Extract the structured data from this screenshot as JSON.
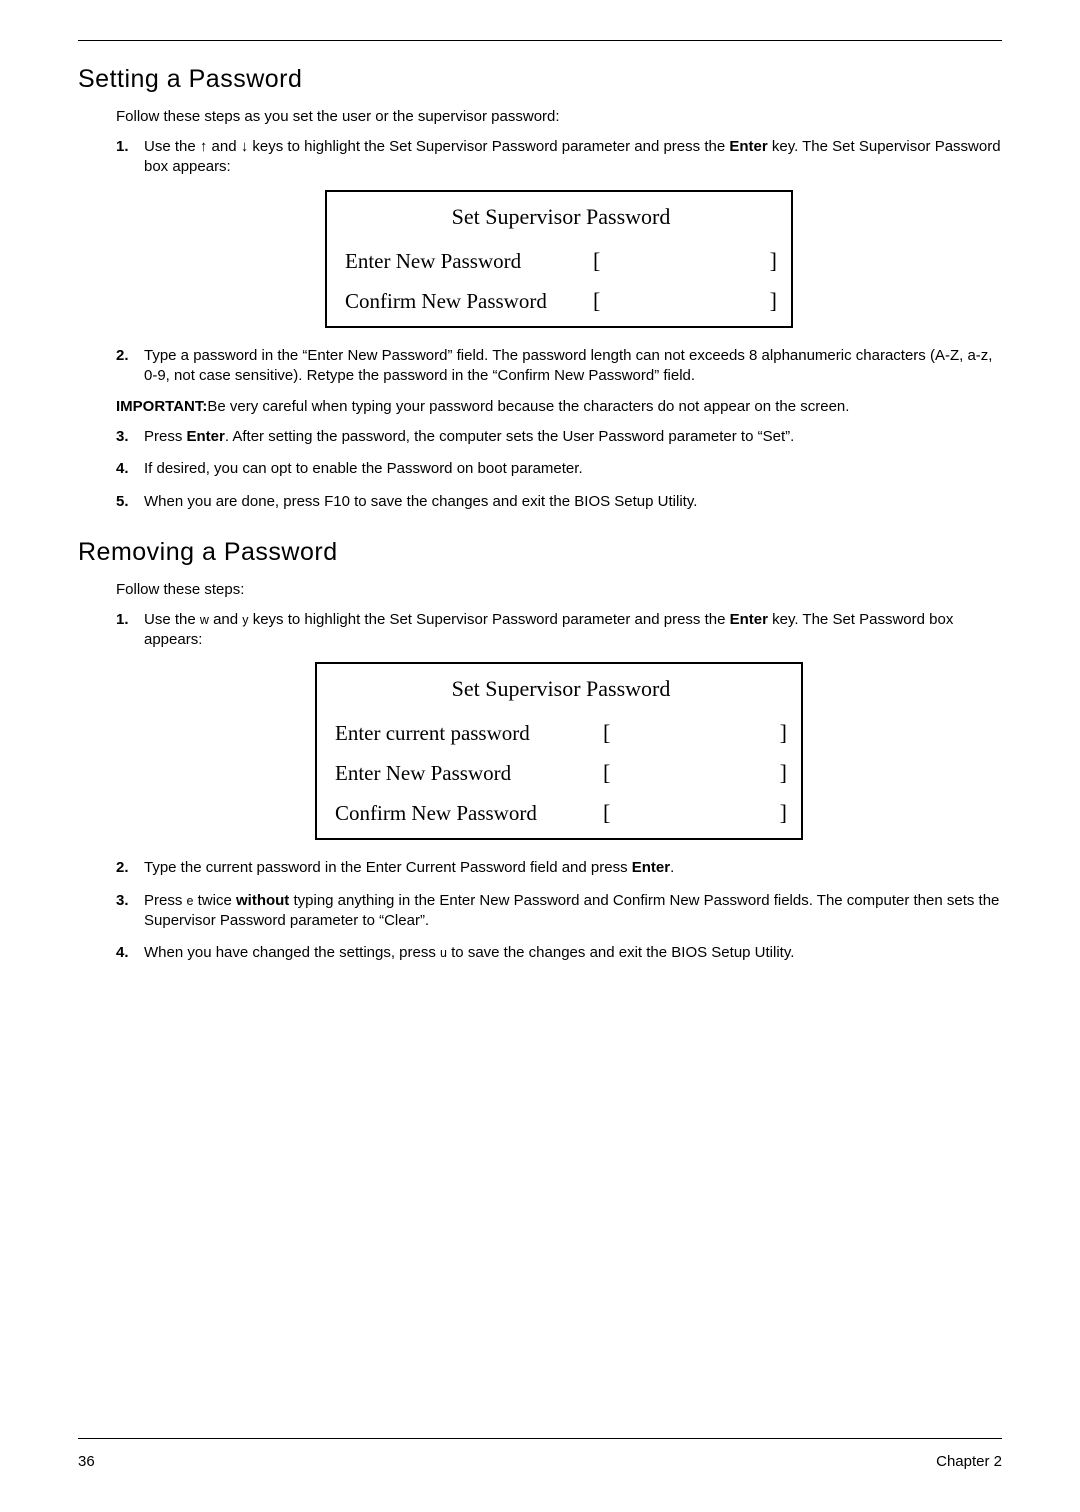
{
  "section1": {
    "heading": "Setting a Password",
    "intro": "Follow these steps as you set the user or the supervisor password:",
    "steps": {
      "s1_num": "1.",
      "s1_a": "Use the ",
      "s1_arrow_up": "↑",
      "s1_mid": " and ",
      "s1_arrow_down": "↓",
      "s1_b": " keys to highlight the Set Supervisor Password parameter and press the ",
      "s1_enter": "Enter",
      "s1_c": " key. The Set Supervisor Password box appears:",
      "s2_num": "2.",
      "s2": "Type a password in the “Enter New Password” field. The password length can not exceeds 8 alphanumeric characters (A-Z, a-z, 0-9, not case sensitive). Retype the password in the “Confirm New Password” field.",
      "important_label": "IMPORTANT:",
      "important_text": "Be very careful when typing your password because the characters do not appear on the screen.",
      "s3_num": "3.",
      "s3_a": "Press ",
      "s3_enter": "Enter",
      "s3_b": ". After setting the password, the computer sets the User Password parameter to “Set”.",
      "s4_num": "4.",
      "s4": "If desired, you can opt to enable the Password on boot parameter.",
      "s5_num": "5.",
      "s5": "When you are done, press F10 to save the changes and exit the BIOS Setup Utility."
    },
    "dialog": {
      "title": "Set Supervisor Password",
      "row1_label": "Enter New Password",
      "row2_label": "Confirm New Password",
      "bracket_open": "[",
      "bracket_close": "]"
    }
  },
  "section2": {
    "heading": "Removing a Password",
    "intro": "Follow these steps:",
    "steps": {
      "s1_num": "1.",
      "s1_a": "Use the ",
      "s1_w": "w",
      "s1_mid": " and ",
      "s1_y": "y",
      "s1_b": " keys to highlight the Set Supervisor Password parameter and press the ",
      "s1_enter": "Enter",
      "s1_c": " key. The Set Password box appears:",
      "s2_num": "2.",
      "s2_a": "Type the current password in the Enter Current Password field and press ",
      "s2_enter": "Enter",
      "s2_b": ".",
      "s3_num": "3.",
      "s3_a": "Press ",
      "s3_e": "e",
      "s3_b": " twice ",
      "s3_without": "without",
      "s3_c": " typing anything in the Enter New Password and Confirm New Password fields. The computer then sets the Supervisor Password parameter to “Clear”.",
      "s4_num": "4.",
      "s4_a": "When you have changed the settings, press ",
      "s4_u": "u",
      "s4_b": " to save the changes and exit the BIOS Setup Utility."
    },
    "dialog": {
      "title": "Set Supervisor Password",
      "row1_label": "Enter current password",
      "row2_label": "Enter New Password",
      "row3_label": "Confirm New Password",
      "bracket_open": "[",
      "bracket_close": "]"
    }
  },
  "footer": {
    "page_num": "36",
    "chapter": "Chapter 2"
  }
}
